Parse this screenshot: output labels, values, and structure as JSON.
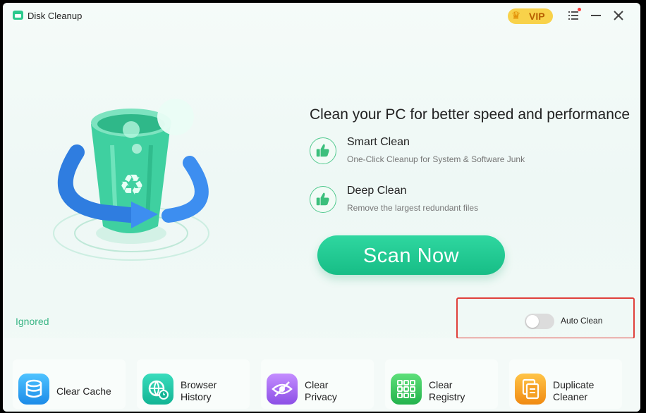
{
  "app": {
    "title": "Disk Cleanup"
  },
  "titlebar": {
    "vip_label": "VIP"
  },
  "hero": {
    "headline": "Clean your PC for better speed and performance"
  },
  "features": [
    {
      "title": "Smart Clean",
      "description": "One-Click Cleanup for System & Software Junk"
    },
    {
      "title": "Deep Clean",
      "description": "Remove the largest redundant files"
    }
  ],
  "scan_button": "Scan Now",
  "ignored_link": "Ignored",
  "auto_clean": {
    "label": "Auto Clean",
    "enabled": false
  },
  "tools": [
    {
      "label_line1": "Clear Cache",
      "label_line2": ""
    },
    {
      "label_line1": "Browser",
      "label_line2": "History"
    },
    {
      "label_line1": "Clear",
      "label_line2": "Privacy"
    },
    {
      "label_line1": "Clear",
      "label_line2": "Registry"
    },
    {
      "label_line1": "Duplicate",
      "label_line2": "Cleaner"
    }
  ],
  "colors": {
    "accent": "#1fc590",
    "highlight_border": "#e0403b",
    "vip": "#f8d24a"
  }
}
